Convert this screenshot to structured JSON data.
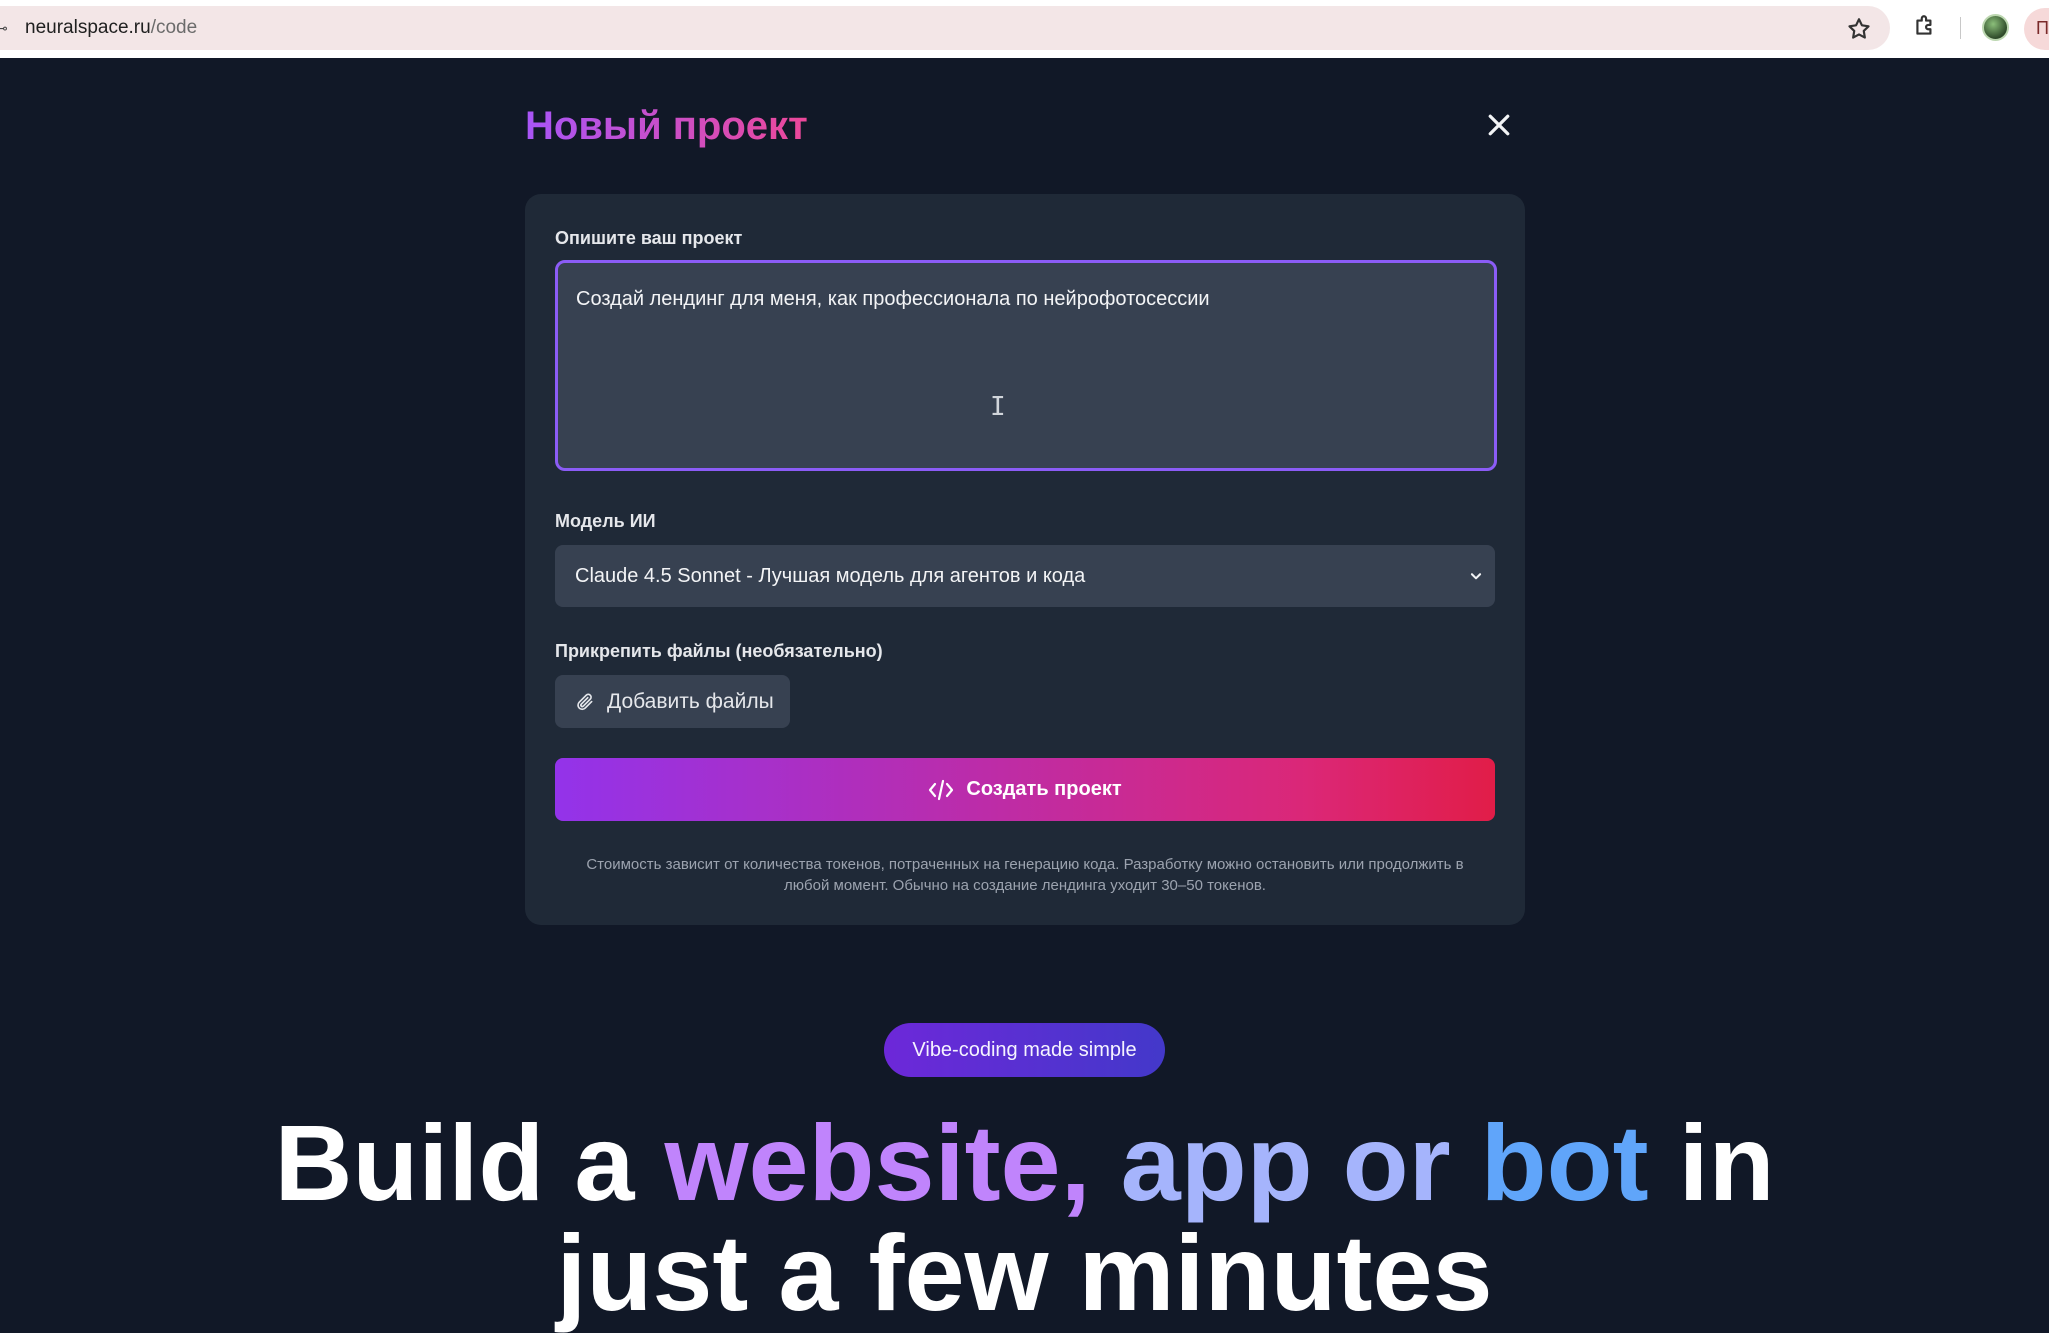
{
  "browser": {
    "url_host": "neuralspace.ru",
    "url_path": "/code",
    "menu_letter": "П"
  },
  "modal": {
    "title": "Новый проект",
    "description_label": "Опишите ваш проект",
    "description_value": "Создай лендинг для меня, как профессионала по нейрофотосессии",
    "model_label": "Модель ИИ",
    "model_selected": "Claude 4.5 Sonnet - Лучшая модель для агентов и кода",
    "attach_label": "Прикрепить файлы (необязательно)",
    "add_files_label": "Добавить файлы",
    "create_label": "Создать проект",
    "note": "Стоимость зависит от количества токенов, потраченных на генерацию кода. Разработку можно остановить или продолжить в любой момент. Обычно на создание лендинга уходит 30–50 токенов."
  },
  "hero": {
    "badge": "Vibe-coding made simple",
    "title_part1": "Build a ",
    "title_part2": "website,",
    "title_part3": " app",
    "title_part4": " or",
    "title_part5": " bot",
    "title_part6": " in",
    "title_line2": "just a few minutes"
  },
  "colors": {
    "accent_purple": "#9333ea",
    "accent_pink": "#db2777",
    "background": "#111827",
    "panel": "#1f2937"
  }
}
